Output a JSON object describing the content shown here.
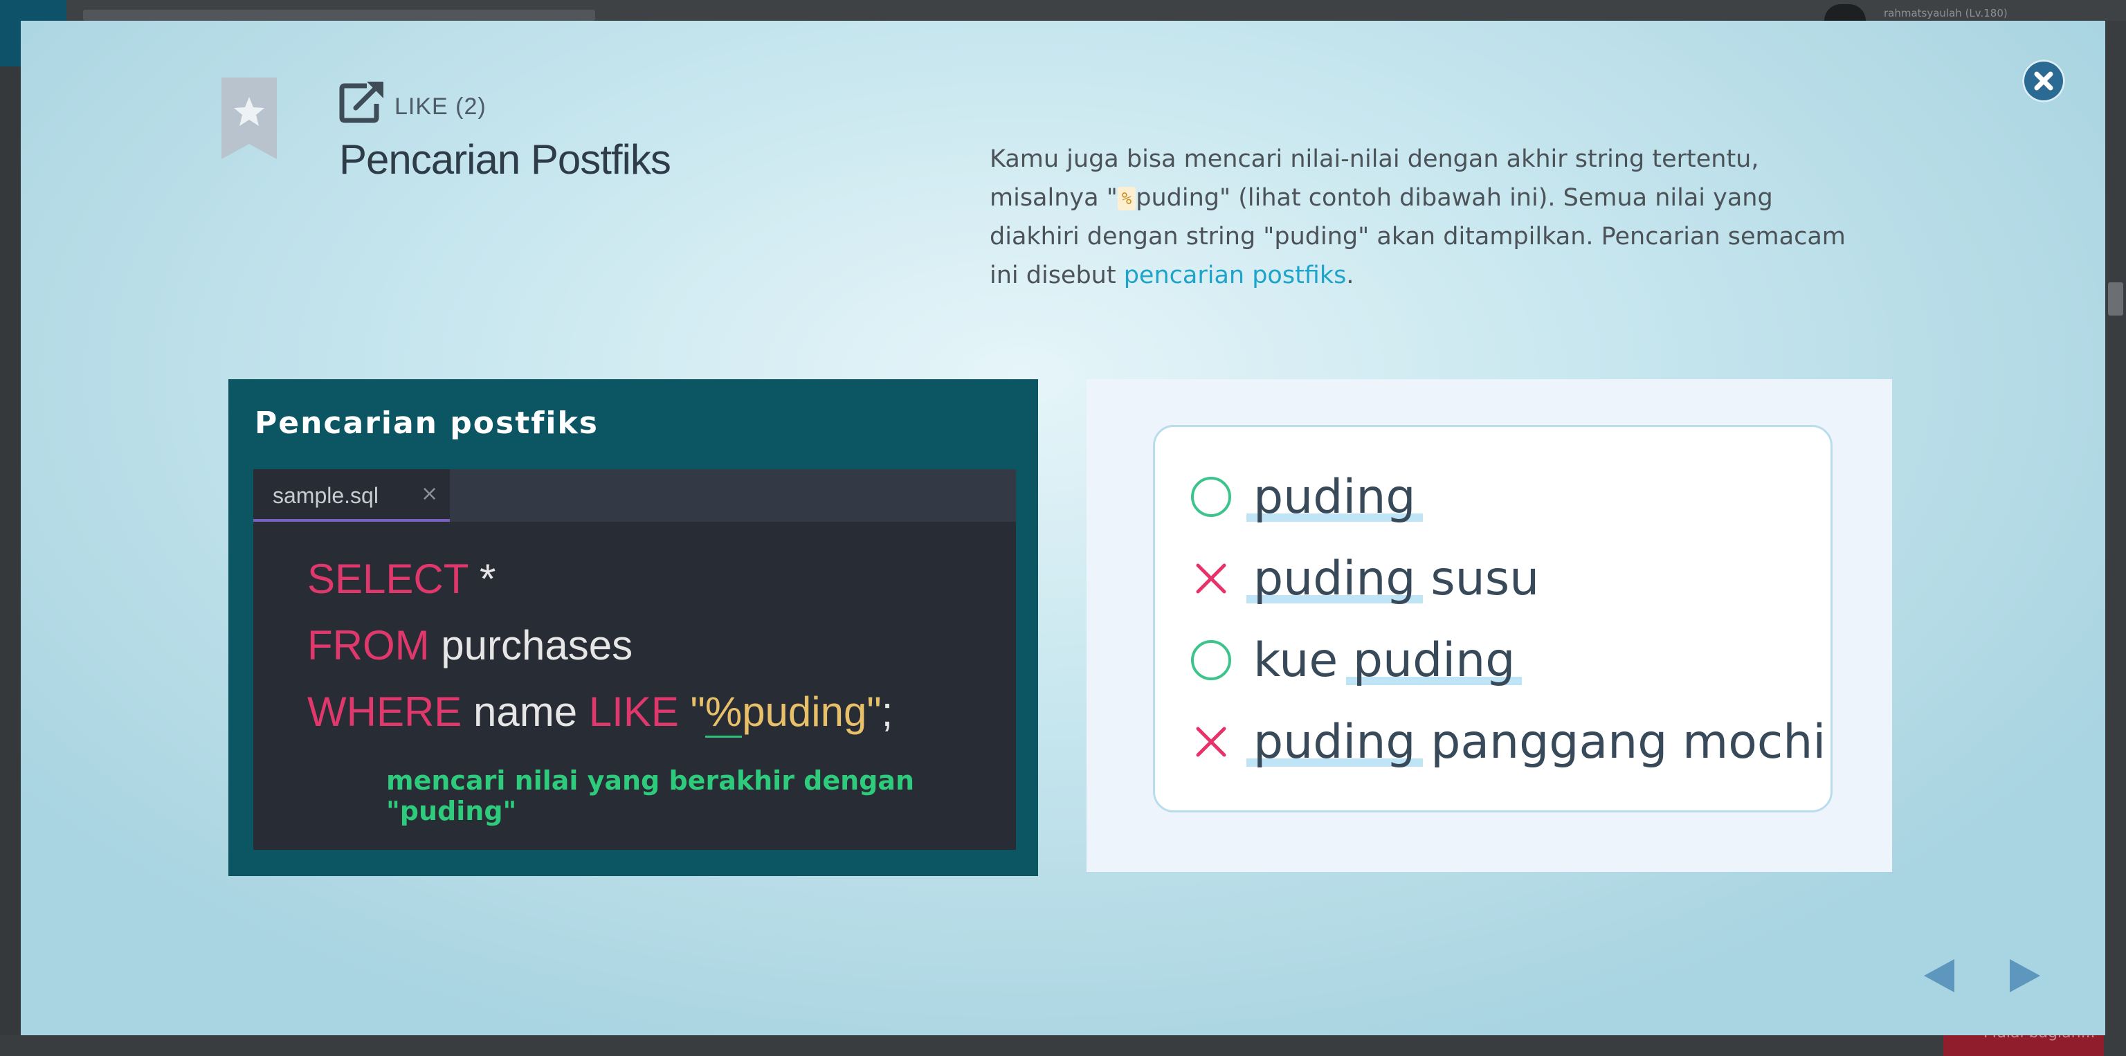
{
  "background": {
    "username": "rahmatsyaulah (Lv.180)",
    "bottom_button_label": "Mulai bagian..."
  },
  "header": {
    "like_label": "LIKE (2)",
    "title": "Pencarian Postfiks"
  },
  "description": {
    "part1": "Kamu juga bisa mencari nilai-nilai dengan akhir string tertentu, misalnya \"",
    "code": "%",
    "part2": "puding\" (lihat contoh dibawah ini). Semua nilai yang diakhiri dengan string \"puding\" akan ditampilkan. Pencarian semacam ini disebut ",
    "link": "pencarian postfiks",
    "end": "."
  },
  "code_slide": {
    "title": "Pencarian postfiks",
    "tab_name": "sample.sql",
    "tab_close": "×",
    "line1_kw": "SELECT",
    "line1_rest": " *",
    "line2_kw": "FROM",
    "line2_rest": " purchases",
    "line3_kw1": "WHERE",
    "line3_mid": " name ",
    "line3_kw2": "LIKE",
    "line3_q1": " \"",
    "line3_pct": "%",
    "line3_str": "puding\"",
    "line3_end": ";",
    "comment": "mencari nilai yang berakhir dengan \"puding\""
  },
  "result_slide": {
    "rows": [
      {
        "mark": "ok",
        "hl": "puding",
        "rest": ""
      },
      {
        "mark": "x",
        "hl": "puding",
        "rest": " susu"
      },
      {
        "mark": "ok",
        "pre": "kue ",
        "hl": "puding",
        "rest": ""
      },
      {
        "mark": "x",
        "hl": "puding",
        "rest": " panggang mochi"
      }
    ]
  },
  "colors": {
    "accent": "#1ea3c9",
    "close_button": "#2a6a93",
    "ok_mark": "#3cc48c",
    "x_mark": "#e8336a",
    "keyword": "#e0386c",
    "comment": "#2ecb7d"
  },
  "icons": {
    "close": "close-x-icon",
    "bookmark": "bookmark-star-icon",
    "external": "external-link-icon",
    "prev": "triangle-left-icon",
    "next": "triangle-right-icon"
  }
}
